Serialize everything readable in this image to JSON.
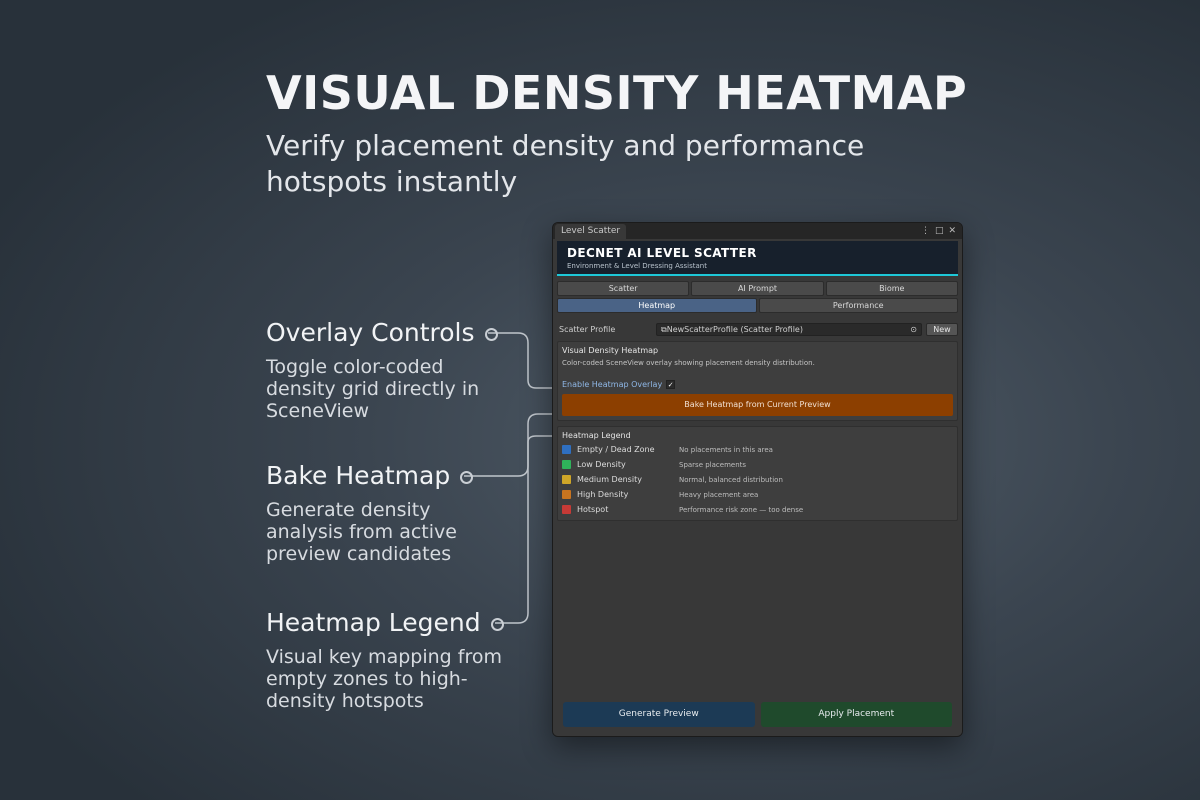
{
  "hero": {
    "title": "VISUAL DENSITY HEATMAP",
    "subtitle": "Verify placement density and performance hotspots instantly"
  },
  "callouts": [
    {
      "title": "Overlay Controls",
      "desc": "Toggle color-coded density grid directly in SceneView"
    },
    {
      "title": "Bake Heatmap",
      "desc": "Generate density analysis from active preview candidates"
    },
    {
      "title": "Heatmap Legend",
      "desc": "Visual key mapping from empty zones to high-density hotspots"
    }
  ],
  "window": {
    "tab_label": "Level Scatter",
    "controls": [
      "⋮",
      "□",
      "✕"
    ],
    "banner_title": "DECNET AI LEVEL SCATTER",
    "banner_subtitle": "Environment & Level Dressing Assistant",
    "tabs_row1": [
      "Scatter",
      "AI Prompt",
      "Biome"
    ],
    "tabs_row2": [
      "Heatmap",
      "Performance"
    ],
    "active_tab": "Heatmap",
    "profile_label": "Scatter Profile",
    "profile_value": "⧉NewScatterProfile (Scatter Profile)",
    "profile_picker_icon": "⊙",
    "new_button": "New",
    "heatmap_section_title": "Visual Density Heatmap",
    "heatmap_section_desc": "Color-coded SceneView overlay showing placement density distribution.",
    "overlay_label": "Enable Heatmap Overlay",
    "overlay_checked_glyph": "✓",
    "bake_button": "Bake Heatmap from Current Preview",
    "legend_title": "Heatmap Legend",
    "legend": [
      {
        "name": "Empty / Dead Zone",
        "desc": "No placements in this area",
        "color": "#2f6fc0"
      },
      {
        "name": "Low Density",
        "desc": "Sparse placements",
        "color": "#2fb25a"
      },
      {
        "name": "Medium Density",
        "desc": "Normal, balanced distribution",
        "color": "#cfa628"
      },
      {
        "name": "High Density",
        "desc": "Heavy placement area",
        "color": "#c8741f"
      },
      {
        "name": "Hotspot",
        "desc": "Performance risk zone — too dense",
        "color": "#c63a36"
      }
    ],
    "generate_button": "Generate Preview",
    "apply_button": "Apply Placement"
  },
  "colors": {
    "accent_cyan": "#1ec8d8",
    "active_tab": "#4a6386",
    "bake_orange": "#8c3f00",
    "generate_blue": "#1c3a55",
    "apply_green": "#1f4a2c"
  }
}
